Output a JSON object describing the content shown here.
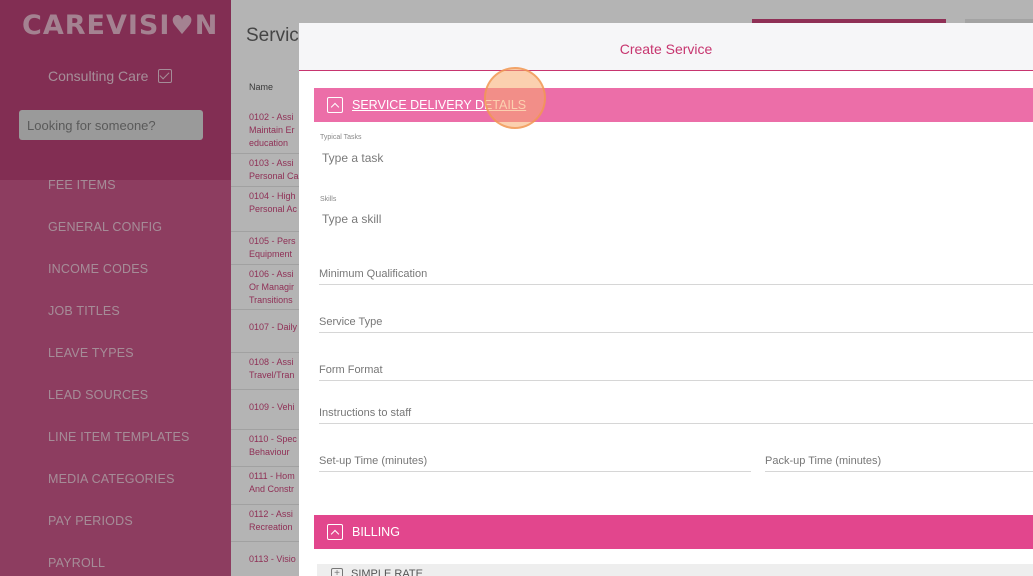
{
  "sidebar": {
    "logo_text": "CAREVISI",
    "logo_tail": "N",
    "org_name": "Consulting Care",
    "search_placeholder": "Looking for someone?",
    "items": [
      {
        "label": "FEE ITEMS"
      },
      {
        "label": "GENERAL CONFIG"
      },
      {
        "label": "INCOME CODES"
      },
      {
        "label": "JOB TITLES"
      },
      {
        "label": "LEAVE TYPES"
      },
      {
        "label": "LEAD SOURCES"
      },
      {
        "label": "LINE ITEM TEMPLATES"
      },
      {
        "label": "MEDIA CATEGORIES"
      },
      {
        "label": "PAY PERIODS"
      },
      {
        "label": "PAYROLL"
      }
    ]
  },
  "page": {
    "title": "Service",
    "column_name": "Name",
    "rows": [
      {
        "l1": "0102 - Assi",
        "l2": "Maintain Er",
        "l3": "education"
      },
      {
        "l1": "0103 - Assi",
        "l2": "Personal Ca",
        "l3": ""
      },
      {
        "l1": "0104 - High",
        "l2": "Personal Ac",
        "l3": ""
      },
      {
        "l1": "0105 - Pers",
        "l2": "Equipment",
        "l3": ""
      },
      {
        "l1": "0106 - Assi",
        "l2": "Or Managir",
        "l3": "Transitions"
      },
      {
        "l1": "0107 - Daily",
        "l2": "",
        "l3": ""
      },
      {
        "l1": "0108 - Assi",
        "l2": "Travel/Tran",
        "l3": ""
      },
      {
        "l1": "0109 - Vehi",
        "l2": "",
        "l3": ""
      },
      {
        "l1": "0110 - Spec",
        "l2": "Behaviour",
        "l3": ""
      },
      {
        "l1": "0111 - Hom",
        "l2": "And Constr",
        "l3": ""
      },
      {
        "l1": "0112 - Assi",
        "l2": "Recreation",
        "l3": ""
      },
      {
        "l1": "0113 - Visio",
        "l2": "",
        "l3": ""
      }
    ]
  },
  "modal": {
    "title": "Create Service",
    "delivery_section": "SERVICE DELIVERY DETAILS",
    "typical_tasks_label": "Typical Tasks",
    "typical_tasks_placeholder": "Type a task",
    "skills_label": "Skills",
    "skills_placeholder": "Type a skill",
    "min_qualification": "Minimum Qualification",
    "service_type": "Service Type",
    "form_format": "Form Format",
    "instructions": "Instructions to staff",
    "setup_time": "Set-up Time (minutes)",
    "packup_time": "Pack-up Time (minutes)",
    "billing_section": "BILLING",
    "simple_rate": "SIMPLE RATE"
  },
  "colors": {
    "brand": "#c7356f",
    "sidebar": "#c4497f",
    "section_bar": "#ec6ea8",
    "billing_bar": "#e2468d"
  }
}
